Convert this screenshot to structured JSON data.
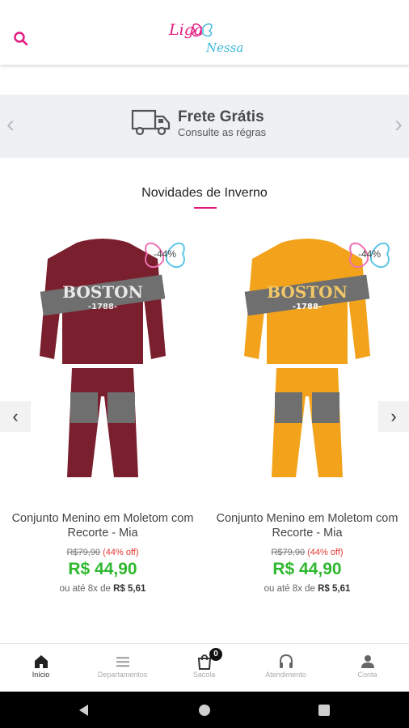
{
  "header": {
    "logo_line1": "Liga",
    "logo_line2": "Nessa",
    "search_icon": "search-icon"
  },
  "banner": {
    "title": "Frete Grátis",
    "subtitle": "Consulte as régras",
    "prev_glyph": "‹",
    "next_glyph": "›",
    "icon": "truck-icon"
  },
  "section": {
    "title": "Novidades de Inverno"
  },
  "carousel": {
    "prev_glyph": "‹",
    "next_glyph": "›"
  },
  "products": [
    {
      "name": "Conjunto Menino em Moletom com Recorte - Mia",
      "old_price": "R$79,90",
      "discount": "(44% off)",
      "price": "R$ 44,90",
      "installments_prefix": "ou até 8x de",
      "installments_value": "R$ 5,61",
      "badge": "-44%",
      "print_text": "BOSTON",
      "print_year": "-1788-",
      "color": "#7a1f2e",
      "accent": "#6f6f6f"
    },
    {
      "name": "Conjunto Menino em Moletom com Recorte - Mia",
      "old_price": "R$79,90",
      "discount": "(44% off)",
      "price": "R$ 44,90",
      "installments_prefix": "ou até 8x de",
      "installments_value": "R$ 5,61",
      "badge": "-44%",
      "print_text": "BOSTON",
      "print_year": "-1788-",
      "color": "#f2a31b",
      "accent": "#6f6f6f"
    }
  ],
  "bottom_nav": {
    "items": [
      {
        "label": "Início",
        "icon": "home-icon",
        "active": true
      },
      {
        "label": "Departamentos",
        "icon": "list-icon",
        "active": false
      },
      {
        "label": "Sacola",
        "icon": "bag-icon",
        "active": false,
        "badge": "0"
      },
      {
        "label": "Atendimento",
        "icon": "headset-icon",
        "active": false
      },
      {
        "label": "Conta",
        "icon": "user-icon",
        "active": false
      }
    ]
  },
  "colors": {
    "brand_pink": "#e3187f",
    "brand_blue": "#38b6d8",
    "price_green": "#2eb82e",
    "discount_red": "#e53935"
  }
}
